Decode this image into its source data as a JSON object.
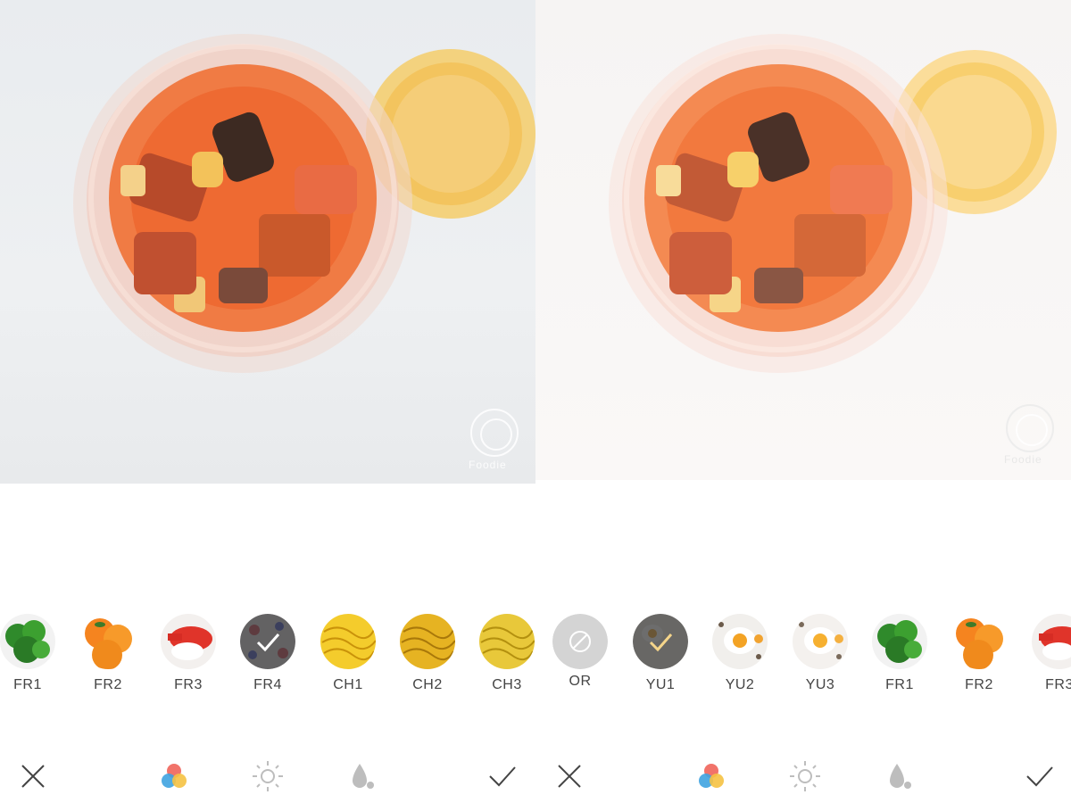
{
  "left": {
    "watermark": "Foodie",
    "filters": [
      {
        "label": "FR1",
        "thumb": "parsley",
        "selected": false
      },
      {
        "label": "FR2",
        "thumb": "oranges",
        "selected": false
      },
      {
        "label": "FR3",
        "thumb": "sushi",
        "selected": false
      },
      {
        "label": "FR4",
        "thumb": "berries",
        "selected": true
      },
      {
        "label": "CH1",
        "thumb": "noodles",
        "selected": false
      },
      {
        "label": "CH2",
        "thumb": "noodles",
        "selected": false
      },
      {
        "label": "CH3",
        "thumb": "noodles",
        "selected": false
      }
    ]
  },
  "right": {
    "watermark": "Foodie",
    "filters": [
      {
        "label": "OR",
        "thumb": "original",
        "selected": false
      },
      {
        "label": "YU1",
        "thumb": "eggs-dark",
        "selected": true
      },
      {
        "label": "YU2",
        "thumb": "egg",
        "selected": false
      },
      {
        "label": "YU3",
        "thumb": "egg",
        "selected": false
      },
      {
        "label": "FR1",
        "thumb": "parsley",
        "selected": false
      },
      {
        "label": "FR2",
        "thumb": "oranges",
        "selected": false
      },
      {
        "label": "FR3",
        "thumb": "sushi",
        "selected": false
      }
    ]
  },
  "toolbar": {
    "icons": [
      "close-icon",
      "filter-color-icon",
      "brightness-icon",
      "drop-icon",
      "confirm-check-icon"
    ]
  },
  "colors": {
    "accent_red": "#f0645a",
    "accent_yellow": "#f5c242",
    "accent_blue": "#3fa3e0",
    "icon_gray": "#bdbdbd",
    "icon_dark": "#444444"
  }
}
